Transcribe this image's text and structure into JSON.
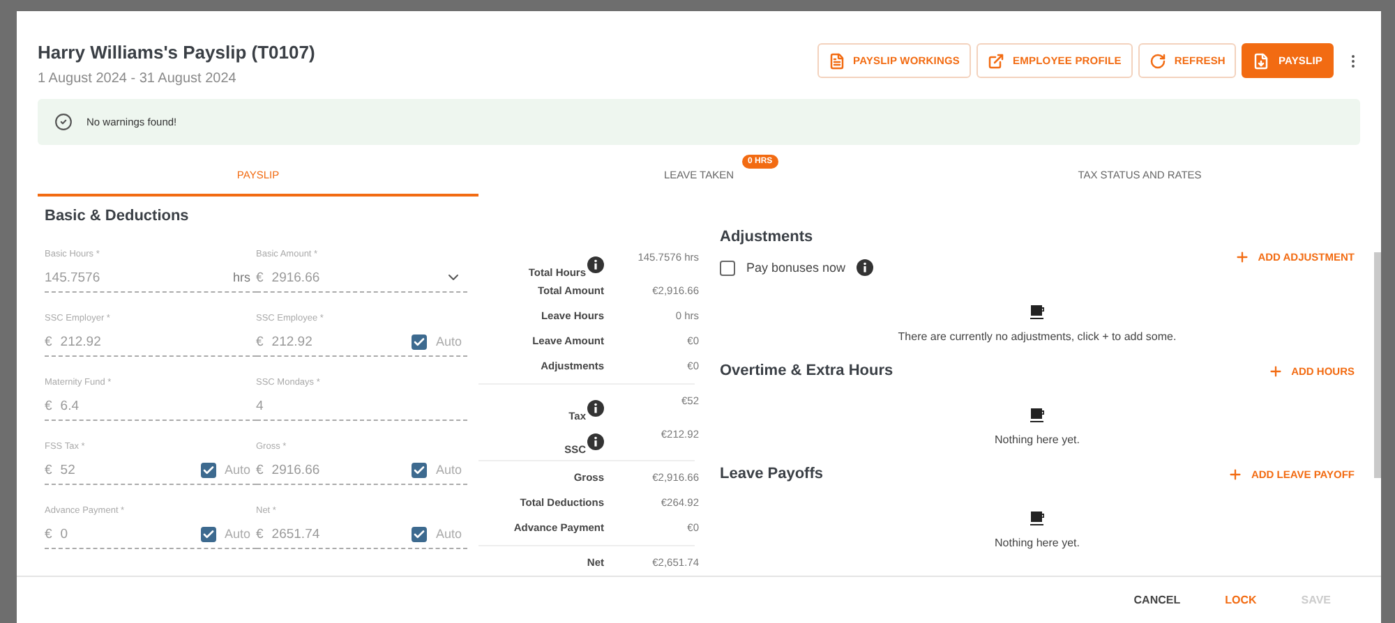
{
  "dialog": {
    "title": "Harry Williams's Payslip (T0107)",
    "period": "1 August 2024 - 31 August 2024"
  },
  "actions": [
    {
      "label": "PAYSLIP WORKINGS",
      "kind": "outline"
    },
    {
      "label": "EMPLOYEE PROFILE",
      "kind": "outline"
    },
    {
      "label": "REFRESH",
      "kind": "outline"
    },
    {
      "label": "PAYSLIP",
      "kind": "primary"
    }
  ],
  "banner": {
    "text": "No warnings found!"
  },
  "tabs": [
    {
      "label": "PAYSLIP",
      "selected": true
    },
    {
      "label": "LEAVE TAKEN",
      "selected": false,
      "badge": "0 HRS"
    },
    {
      "label": "TAX STATUS AND RATES",
      "selected": false
    }
  ],
  "basic": {
    "title": "Basic & Deductions",
    "fields": [
      {
        "label": "Basic Hours *",
        "value": "145.7576",
        "suffix": "hrs"
      },
      {
        "label": "Basic Amount *",
        "prefix": "€",
        "value": "2916.66",
        "dropdown": true
      },
      {
        "label": "SSC Employer *",
        "prefix": "€",
        "value": "212.92"
      },
      {
        "label": "SSC Employee *",
        "prefix": "€",
        "value": "212.92",
        "auto": {
          "label": "Auto",
          "checked": true
        }
      },
      {
        "label": "Maternity Fund *",
        "prefix": "€",
        "value": "6.4"
      },
      {
        "label": "SSC Mondays *",
        "value": "4"
      },
      {
        "label": "FSS Tax *",
        "prefix": "€",
        "value": "52",
        "auto": {
          "label": "Auto",
          "checked": true
        }
      },
      {
        "label": "Gross *",
        "prefix": "€",
        "value": "2916.66",
        "auto": {
          "label": "Auto",
          "checked": true
        }
      },
      {
        "label": "Advance Payment *",
        "prefix": "€",
        "value": "0",
        "auto": {
          "label": "Auto",
          "checked": true
        }
      },
      {
        "label": "Net *",
        "prefix": "€",
        "value": "2651.74",
        "auto": {
          "label": "Auto",
          "checked": true
        }
      }
    ]
  },
  "summary": [
    [
      {
        "label": "Total Hours",
        "value": "145.7576 hrs",
        "info": true
      },
      {
        "label": "Total Amount",
        "value": "€2,916.66",
        "info": false
      },
      {
        "label": "Leave Hours",
        "value": "0 hrs",
        "info": false
      },
      {
        "label": "Leave Amount",
        "value": "€0",
        "info": false
      },
      {
        "label": "Adjustments",
        "value": "€0",
        "info": false
      }
    ],
    [
      {
        "label": "Tax",
        "value": "€52",
        "info": true
      },
      {
        "label": "SSC",
        "value": "€212.92",
        "info": true
      }
    ],
    [
      {
        "label": "Gross",
        "value": "€2,916.66",
        "info": false
      },
      {
        "label": "Total Deductions",
        "value": "€264.92",
        "info": false
      },
      {
        "label": "Advance Payment",
        "value": "€0",
        "info": false
      }
    ],
    [
      {
        "label": "Net",
        "value": "€2,651.74",
        "info": false
      }
    ]
  ],
  "sections": [
    {
      "title": "Adjustments",
      "action": "ADD ADJUSTMENT",
      "checkbox": {
        "label": "Pay bonuses now",
        "checked": false
      },
      "empty": "There are currently no adjustments, click + to add some."
    },
    {
      "title": "Overtime & Extra Hours",
      "action": "ADD HOURS",
      "empty": "Nothing here yet."
    },
    {
      "title": "Leave Payoffs",
      "action": "ADD LEAVE PAYOFF",
      "empty": "Nothing here yet."
    }
  ],
  "footer": [
    {
      "label": "CANCEL",
      "kind": "text",
      "disabled": false
    },
    {
      "label": "LOCK",
      "kind": "accent",
      "disabled": false
    },
    {
      "label": "SAVE",
      "kind": "text",
      "disabled": true
    }
  ]
}
